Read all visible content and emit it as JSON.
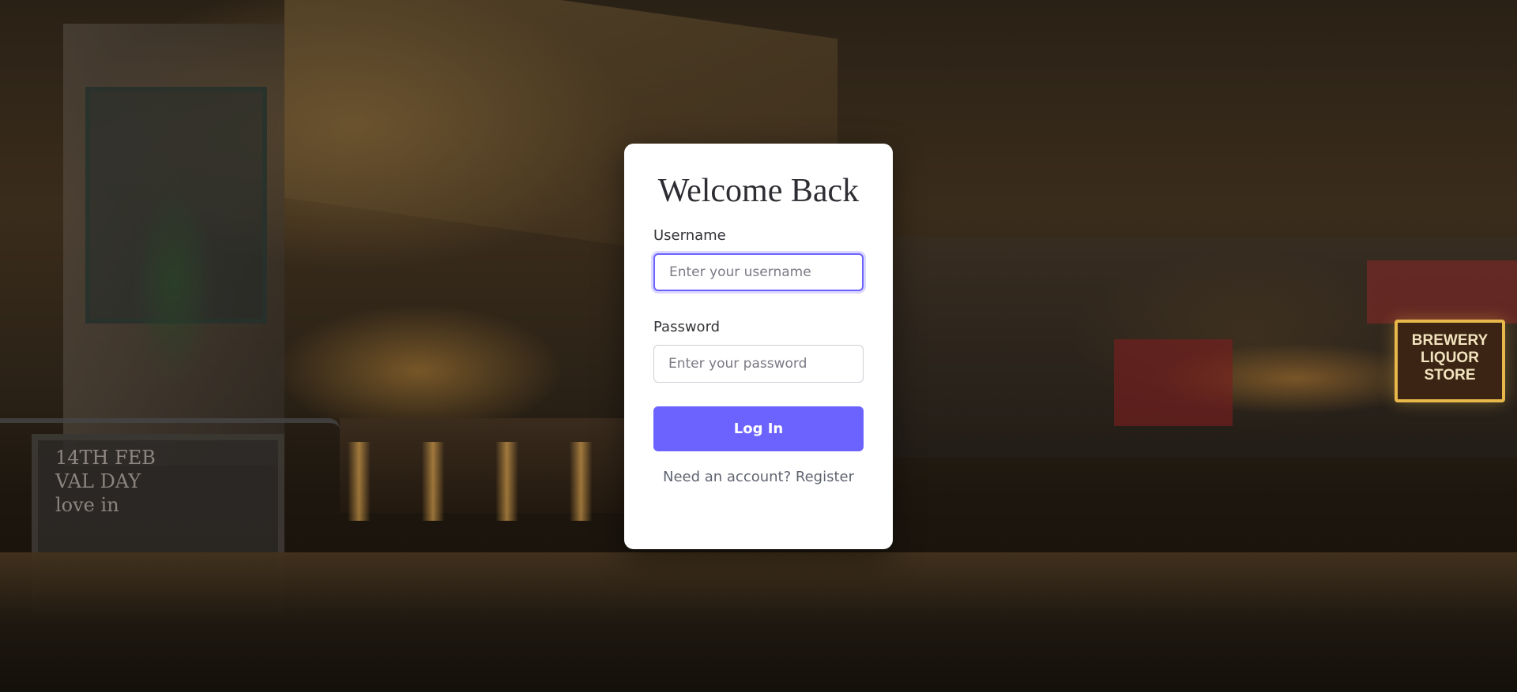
{
  "background": {
    "sign": {
      "lines": [
        "BREWERY",
        "LIQUOR",
        "STORE"
      ]
    },
    "chalkboard": {
      "lines": [
        "14TH  FEB",
        "VAL  DAY",
        "love in"
      ]
    }
  },
  "login": {
    "title": "Welcome Back",
    "username": {
      "label": "Username",
      "placeholder": "Enter your username",
      "value": ""
    },
    "password": {
      "label": "Password",
      "placeholder": "Enter your password",
      "value": ""
    },
    "submit_label": "Log In",
    "register_prompt": "Need an account?",
    "register_link": "Register"
  },
  "colors": {
    "accent": "#6c63ff",
    "card": "#ffffff",
    "title_text": "#2d2d33",
    "muted_text": "#5f6470"
  }
}
